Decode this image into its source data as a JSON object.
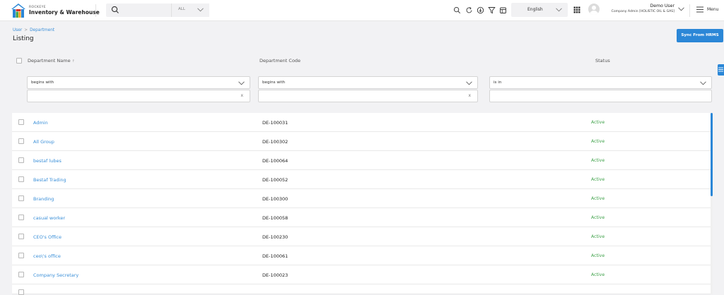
{
  "brand": {
    "small": "ROCKEYE",
    "name": "Inventory & Warehouse",
    "colors": {
      "blue": "#2b87d7",
      "orange": "#f5a623",
      "red": "#d8322b",
      "green": "#3fa24a"
    }
  },
  "search": {
    "placeholder": "",
    "scope": "ALL"
  },
  "toolbar_icons": [
    "search-icon",
    "refresh-icon",
    "download-icon",
    "filter-icon",
    "calendar-icon"
  ],
  "language": "English",
  "user": {
    "name": "Demo User",
    "role": "Company Admin [HOLISTIC OIL & GAS]"
  },
  "menu_label": "Menu",
  "breadcrumb": [
    "User",
    "Department"
  ],
  "page_title": "Listing",
  "sync_button": "Sync From HRMS",
  "table": {
    "columns": [
      "Department Name",
      "Department Code",
      "Status"
    ],
    "filters": [
      {
        "operator": "begins with",
        "value": ""
      },
      {
        "operator": "begins with",
        "value": ""
      },
      {
        "operator": "is in",
        "value": ""
      }
    ],
    "clear_glyph": "x",
    "rows": [
      {
        "name": "Admin",
        "code": "DE-100031",
        "status": "Active"
      },
      {
        "name": "All Group",
        "code": "DE-100302",
        "status": "Active"
      },
      {
        "name": "bestaf lubes",
        "code": "DE-100064",
        "status": "Active"
      },
      {
        "name": "Bestaf Trading",
        "code": "DE-100052",
        "status": "Active"
      },
      {
        "name": "Branding",
        "code": "DE-100300",
        "status": "Active"
      },
      {
        "name": "casual worker",
        "code": "DE-100058",
        "status": "Active"
      },
      {
        "name": "CEO's Office",
        "code": "DE-100230",
        "status": "Active"
      },
      {
        "name": "ceo\\'s office",
        "code": "DE-100061",
        "status": "Active"
      },
      {
        "name": "Company Secretary",
        "code": "DE-100023",
        "status": "Active"
      }
    ]
  }
}
